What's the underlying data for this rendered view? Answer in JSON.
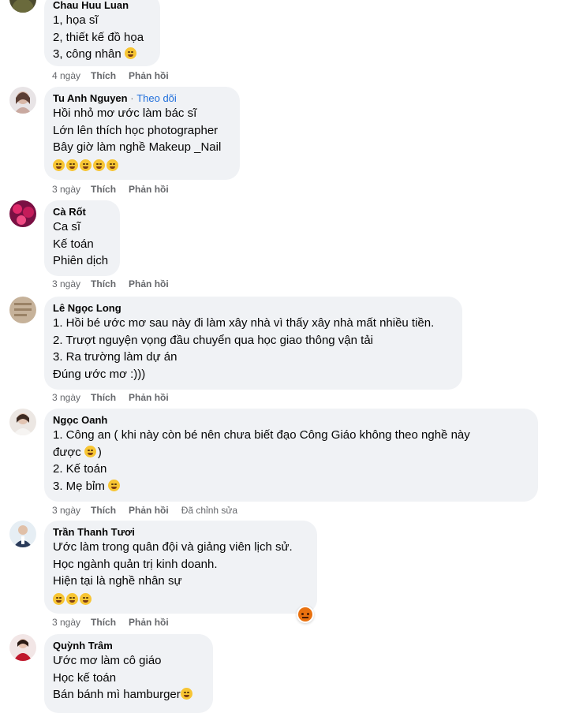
{
  "comments": [
    {
      "author": "Chau Huu Luan",
      "follow": "",
      "lines": [
        "1, họa sĩ",
        "2, thiết kế đồ họa",
        "3, công nhân"
      ],
      "emojis": [
        0,
        0,
        1
      ],
      "time": "4 ngày",
      "like": "Thích",
      "reply": "Phản hồi",
      "edited": ""
    },
    {
      "author": "Tu Anh Nguyen",
      "follow": "Theo dõi",
      "lines": [
        "Hồi nhỏ mơ ước làm bác sĩ",
        "Lớn lên thích học photographer",
        "Bây giờ làm nghề Makeup _Nail",
        ""
      ],
      "emojis": [
        0,
        0,
        0,
        5
      ],
      "time": "3 ngày",
      "like": "Thích",
      "reply": "Phản hồi",
      "edited": ""
    },
    {
      "author": "Cà Rốt",
      "follow": "",
      "lines": [
        "Ca sĩ",
        "Kế toán",
        "Phiên dịch"
      ],
      "emojis": [
        0,
        0,
        0
      ],
      "time": "3 ngày",
      "like": "Thích",
      "reply": "Phản hồi",
      "edited": ""
    },
    {
      "author": "Lê Ngọc Long",
      "follow": "",
      "lines": [
        "1. Hồi bé ước mơ sau này đi làm xây nhà vì thấy xây nhà mất nhiều tiền.",
        "2. Trượt nguyện vọng đầu chuyển qua học giao thông vận tải",
        "3. Ra trường làm dự án",
        "Đúng ước mơ :)))"
      ],
      "emojis": [
        0,
        0,
        0,
        0
      ],
      "time": "3 ngày",
      "like": "Thích",
      "reply": "Phản hồi",
      "edited": ""
    },
    {
      "author": "Ngọc Oanh",
      "follow": "",
      "lines": [
        "1. Công an ( khi này còn bé nên chưa biết đạo Công Giáo không theo nghề này",
        "được",
        "2. Kế toán",
        "3. Mẹ bỉm"
      ],
      "emojis": [
        0,
        1,
        0,
        1
      ],
      "time": "3 ngày",
      "like": "Thích",
      "reply": "Phản hồi",
      "edited": "Đã chỉnh sửa"
    },
    {
      "author": "Trần Thanh Tươi",
      "follow": "",
      "lines": [
        "Ước làm trong quân đội và giảng viên lịch sử.",
        "Học ngành quản trị kinh doanh.",
        "Hiện tại là nghề nhân sự",
        ""
      ],
      "emojis": [
        0,
        0,
        0,
        3
      ],
      "time": "3 ngày",
      "like": "Thích",
      "reply": "Phản hồi",
      "edited": ""
    },
    {
      "author": "Quỳnh Trâm",
      "follow": "",
      "lines": [
        "Ước mơ làm cô giáo",
        "Học kế toán",
        "Bán bánh mì hamburger"
      ],
      "emojis": [
        0,
        0,
        1
      ],
      "time": "",
      "like": "",
      "reply": "",
      "edited": ""
    }
  ],
  "extra": {
    "follow_separator": "·",
    "ngoc_oanh_tail": ")"
  },
  "colors": {
    "bubble": "#f0f2f5",
    "follow_link": "#216fdb",
    "meta_text": "#65676b",
    "angry_reaction": "#e9710f"
  },
  "reaction": {
    "icon": "angry-reaction-icon"
  }
}
